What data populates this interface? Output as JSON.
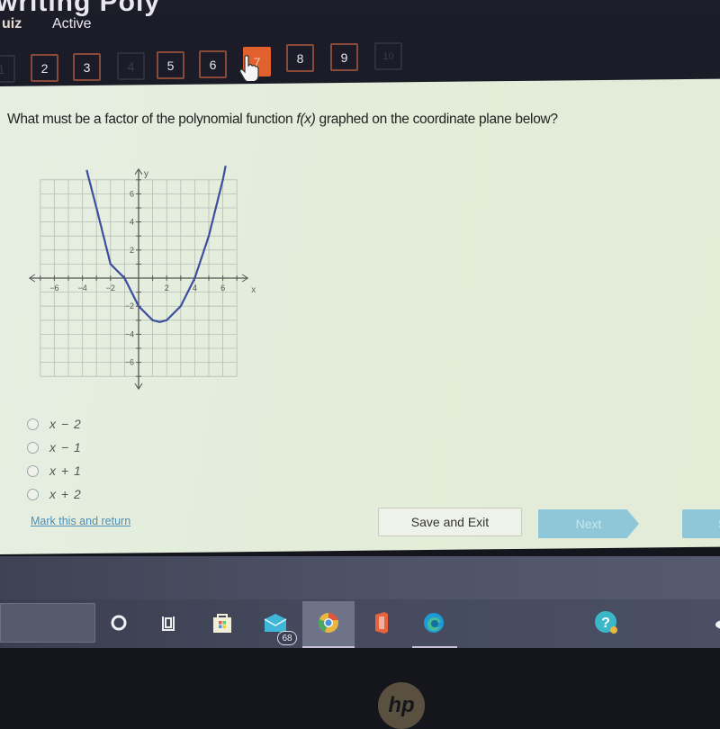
{
  "header": {
    "title_partial": "writing Poly",
    "quiz_label": "uiz",
    "status": "Active"
  },
  "question_nav": {
    "items": [
      {
        "label": "1",
        "state": "disabled"
      },
      {
        "label": "2",
        "state": "normal"
      },
      {
        "label": "3",
        "state": "normal"
      },
      {
        "label": "4",
        "state": "disabled"
      },
      {
        "label": "5",
        "state": "normal"
      },
      {
        "label": "6",
        "state": "normal"
      },
      {
        "label": "7",
        "state": "current"
      },
      {
        "label": "8",
        "state": "normal"
      },
      {
        "label": "9",
        "state": "normal"
      },
      {
        "label": "10",
        "state": "disabled"
      }
    ],
    "colors": {
      "current": "#e0612d",
      "border": "#8a4a3a"
    }
  },
  "question": {
    "text_before": "What must be a factor of the polynomial function ",
    "function_name": "f(x)",
    "text_after": " graphed on the coordinate plane below?"
  },
  "chart_data": {
    "type": "line",
    "title": "",
    "xlabel": "x",
    "ylabel": "y",
    "xlim": [
      -7,
      7
    ],
    "ylim": [
      -7,
      7
    ],
    "grid": true,
    "x_ticks": [
      -6,
      -4,
      -2,
      2,
      4,
      6
    ],
    "y_ticks": [
      -6,
      -4,
      -2,
      2,
      4,
      6
    ],
    "series": [
      {
        "name": "f(x)",
        "color": "#3a4fa0",
        "x": [
          -3.7,
          -3,
          -2,
          -1,
          0,
          1,
          1.5,
          2,
          3,
          4,
          5,
          6,
          6.2
        ],
        "y": [
          7.7,
          5,
          1,
          0,
          -2,
          -3,
          -3.125,
          -3,
          -2,
          0,
          3,
          7,
          8
        ]
      }
    ],
    "annotations": {
      "x_intercepts": [
        -1,
        4
      ],
      "y_intercept": -2
    }
  },
  "choices": [
    {
      "label": "x − 2"
    },
    {
      "label": "x − 1"
    },
    {
      "label": "x + 1"
    },
    {
      "label": "x + 2"
    }
  ],
  "footer": {
    "mark_link": "Mark this and return",
    "save_exit": "Save and Exit",
    "next": "Next",
    "submit": "S"
  },
  "taskbar": {
    "icons": [
      "cortana-icon",
      "task-view-icon",
      "store-icon",
      "mail-icon",
      "chrome-icon",
      "office-icon",
      "edge-icon",
      "help-icon"
    ],
    "mail_badge": "68"
  },
  "bezel": {
    "logo": "hp"
  }
}
